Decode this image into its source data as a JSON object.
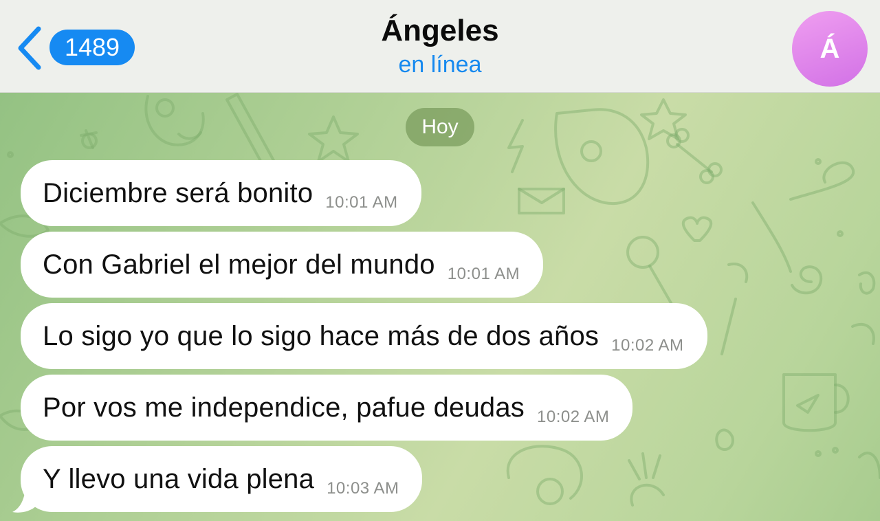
{
  "header": {
    "back_label": "",
    "unread_count": "1489",
    "contact_name": "Ángeles",
    "status": "en línea",
    "avatar_initial": "Á",
    "avatar_colors": [
      "#ef9ef0",
      "#d271e6"
    ],
    "accent_color": "#168af2"
  },
  "chat": {
    "date_label": "Hoy",
    "messages": [
      {
        "text": "Diciembre será bonito",
        "time": "10:01 AM"
      },
      {
        "text": "Con Gabriel el mejor del mundo",
        "time": "10:01 AM"
      },
      {
        "text": "Lo sigo yo que lo sigo hace más de dos años",
        "time": "10:02 AM"
      },
      {
        "text": "Por vos me independice, pafue deudas",
        "time": "10:02 AM"
      },
      {
        "text": "Y llevo una vida plena",
        "time": "10:03 AM"
      }
    ]
  },
  "icons": {
    "back": "chevron-left-icon",
    "background": "doodle-pattern"
  }
}
